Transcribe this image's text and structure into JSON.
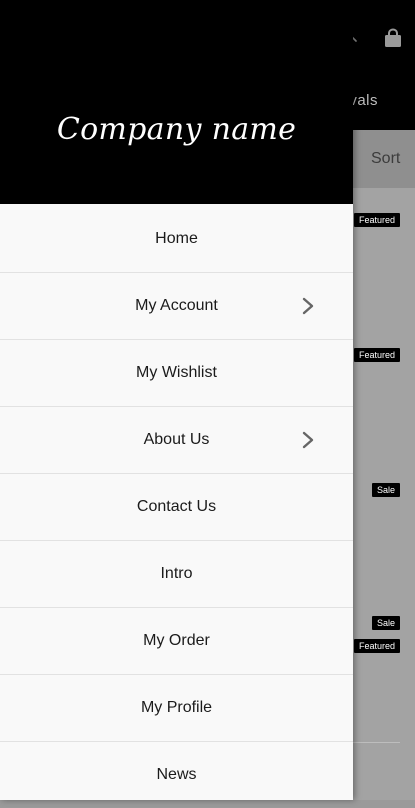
{
  "background": {
    "tab_partial": "rivals",
    "sort_label": "Sort",
    "badges": [
      "Featured",
      "Featured",
      "Sale",
      "Sale",
      "Featured"
    ]
  },
  "drawer": {
    "brand": "Company name",
    "items": [
      {
        "label": "Home",
        "has_submenu": false
      },
      {
        "label": "My Account",
        "has_submenu": true
      },
      {
        "label": "My Wishlist",
        "has_submenu": false
      },
      {
        "label": "About Us",
        "has_submenu": true
      },
      {
        "label": "Contact Us",
        "has_submenu": false
      },
      {
        "label": "Intro",
        "has_submenu": false
      },
      {
        "label": "My Order",
        "has_submenu": false
      },
      {
        "label": "My Profile",
        "has_submenu": false
      },
      {
        "label": "News",
        "has_submenu": false
      }
    ]
  },
  "icons": {
    "palette": "palette-icon",
    "close": "close-icon",
    "cart": "shopping-bag-icon"
  },
  "colors": {
    "header": "#000000",
    "drawer_bg": "#f9f9f9",
    "overlay": "#9a9a9a"
  }
}
